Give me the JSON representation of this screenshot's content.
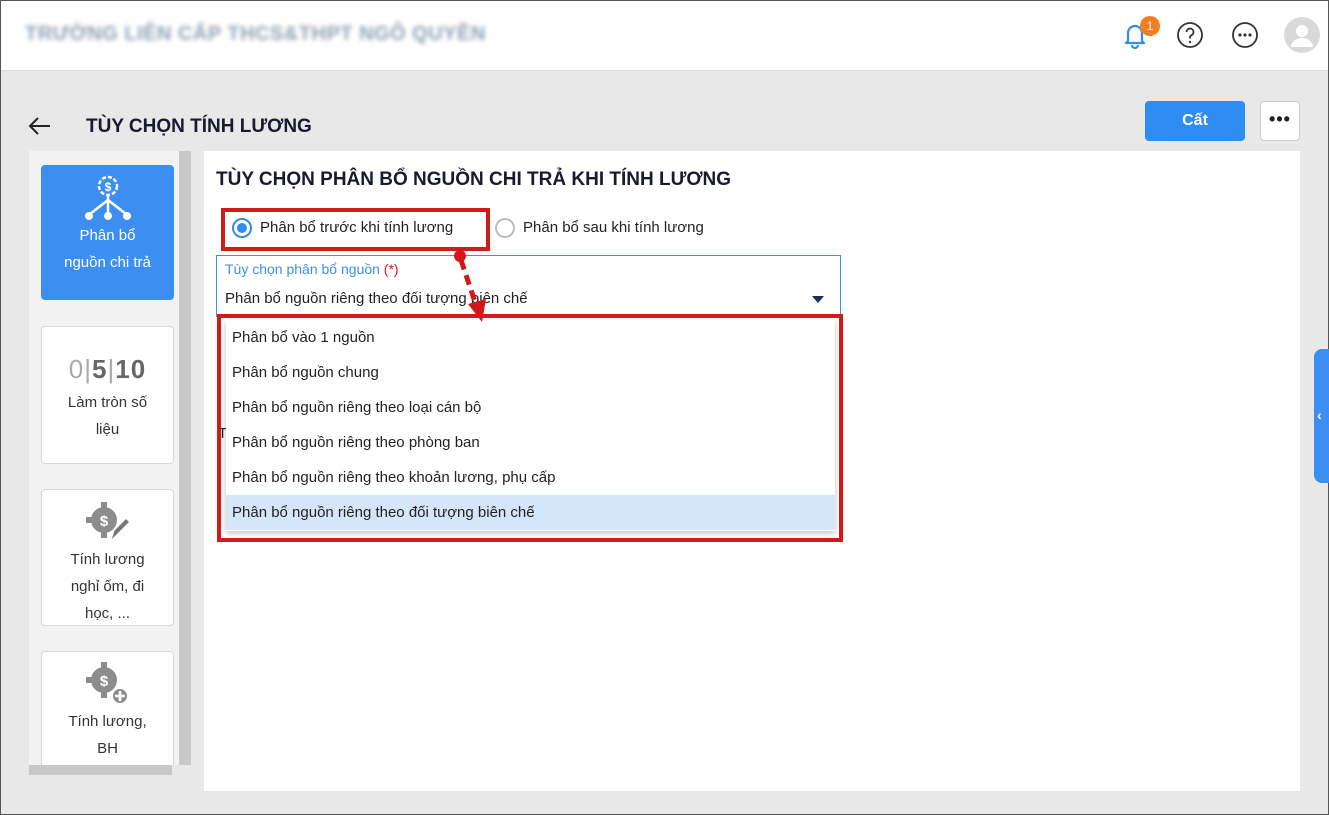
{
  "header": {
    "school_name": "TRƯỜNG LIÊN CẤP THCS&THPT NGÔ QUYỀN",
    "notification_count": "1",
    "icons": [
      "bell-icon",
      "help-icon",
      "more-options-icon",
      "avatar-icon"
    ]
  },
  "page": {
    "title": "TÙY CHỌN TÍNH LƯƠNG",
    "save_label": "Cất",
    "more_label": "•••"
  },
  "sidebar": {
    "items": [
      {
        "label": "Phân bổ nguồn chi trả",
        "icon": "money-network-icon",
        "active": true
      },
      {
        "label": "Làm tròn số liệu",
        "icon": "rounding-digits-icon",
        "digits": [
          "0",
          "5",
          "10"
        ],
        "active": false
      },
      {
        "label": "Tính lương nghỉ ốm, đi học, ...",
        "icon": "money-gear-edit-icon",
        "active": false
      },
      {
        "label": "Tính lương, BH",
        "icon": "money-gear-plus-icon",
        "active": false
      }
    ]
  },
  "main": {
    "section_title": "TÙY CHỌN PHÂN BỔ NGUỒN CHI TRẢ KHI TÍNH LƯƠNG",
    "radio_before": "Phân bổ trước khi tính lương",
    "radio_after": "Phân bổ sau khi tính lương",
    "selected_radio": "before",
    "select": {
      "label": "Tùy chọn phân bổ nguồn",
      "required_mark": "(*)",
      "value": "Phân bổ nguồn riêng theo đối tượng biên chế"
    },
    "dropdown_options": [
      "Phân bổ vào 1 nguồn",
      "Phân bổ nguồn chung",
      "Phân bổ nguồn riêng theo loại cán bộ",
      "Phân bổ nguồn riêng theo phòng ban",
      "Phân bổ nguồn riêng theo khoản lương, phụ cấp",
      "Phân bổ nguồn riêng theo đối tượng biên chế"
    ],
    "selected_option_index": 5,
    "partial_text": "T"
  },
  "colors": {
    "accent": "#2f8cf0",
    "highlight": "#d11a1a",
    "badge": "#f57c1f",
    "selected_row": "#d5e6fb"
  }
}
